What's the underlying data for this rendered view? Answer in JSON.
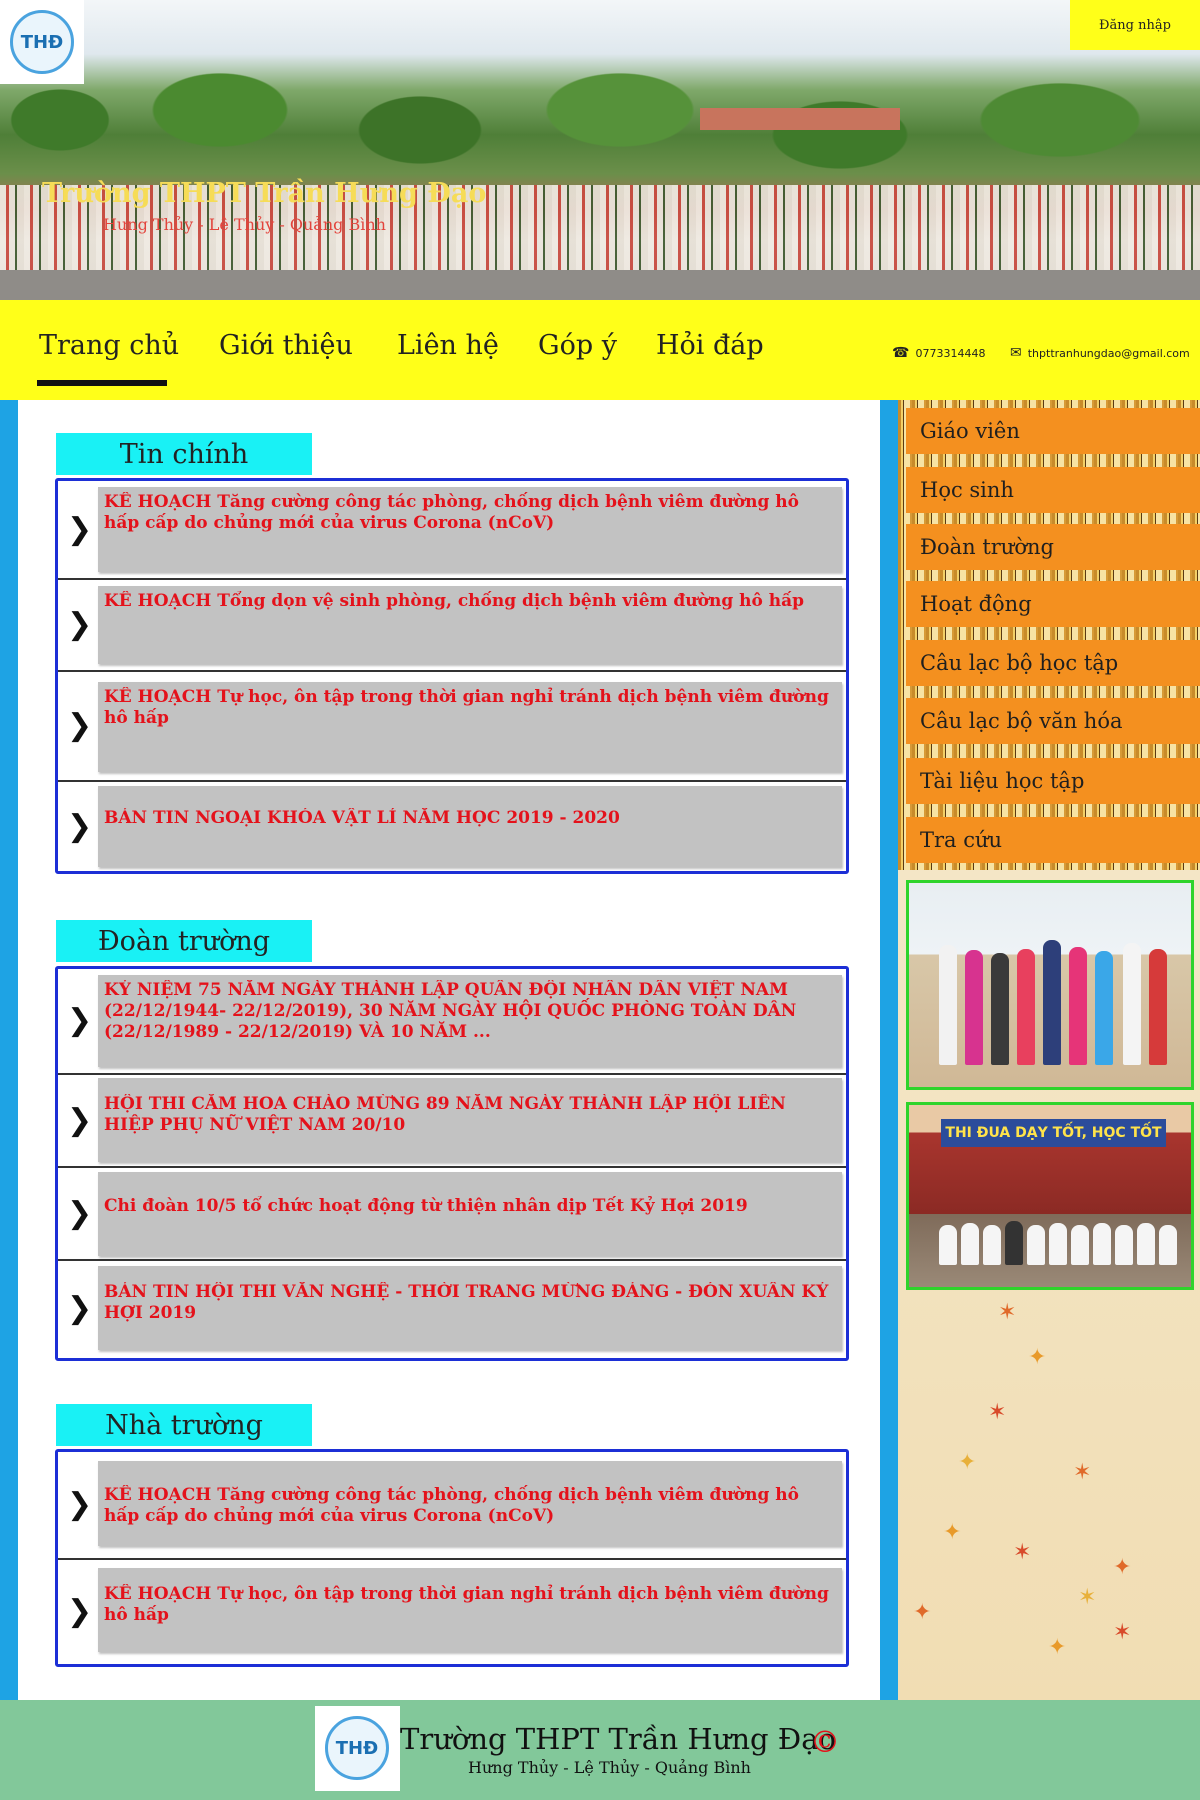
{
  "header": {
    "logo_text": "THĐ",
    "login_label": "Đăng nhập",
    "site_title": "Trường THPT Trần Hưng Đạo",
    "site_subtitle": "Hưng Thủy - Lệ Thủy - Quảng Bình"
  },
  "nav": {
    "items": [
      {
        "label": "Trang chủ"
      },
      {
        "label": "Giới thiệu"
      },
      {
        "label": "Liên hệ"
      },
      {
        "label": "Góp ý"
      },
      {
        "label": "Hỏi đáp"
      }
    ],
    "active_index": 0,
    "phone": "0773314448",
    "email": "thpttranhungdao@gmail.com"
  },
  "sections": [
    {
      "title": "Tin chính",
      "items": [
        {
          "text": "KẾ HOẠCH Tăng cường công tác phòng, chống dịch bệnh  viêm đường hô hấp cấp do chủng mới của virus Corona (nCoV)"
        },
        {
          "text": "KẾ HOẠCH Tổng dọn vệ sinh phòng, chống dịch bệnh viêm đường hô hấp"
        },
        {
          "text": "KẾ HOẠCH Tự học, ôn tập trong thời gian nghỉ tránh dịch bệnh viêm đường hô hấp"
        },
        {
          "text": "BẢN TIN NGOẠI KHÓA VẬT LÍ NĂM HỌC 2019 - 2020"
        }
      ]
    },
    {
      "title": "Đoàn trường",
      "items": [
        {
          "text": "KỶ NIỆM 75 NĂM NGÀY THÀNH LẬP QUÂN ĐỘI NHÂN DÂN VIỆT NAM (22/12/1944- 22/12/2019), 30 NĂM NGÀY HỘI QUỐC PHÒNG TOÀN DÂN (22/12/1989 - 22/12/2019) VÀ 10 NĂM ..."
        },
        {
          "text": "HỘI THI CẮM HOA CHÀO MỪNG 89 NĂM NGÀY THÀNH LẬP HỘI LIÊN HIỆP PHỤ NỮ VIỆT NAM 20/10"
        },
        {
          "text": "Chi đoàn 10/5 tổ chức hoạt động từ thiện nhân dịp Tết Kỷ Hợi 2019"
        },
        {
          "text": "BẢN TIN HỘI THI VĂN NGHỆ - THỜI TRANG MỪNG ĐẢNG - ĐÓN XUÂN KỶ HỢI 2019"
        }
      ]
    },
    {
      "title": "Nhà trường",
      "items": [
        {
          "text": "KẾ HOẠCH Tăng cường công tác phòng, chống dịch bệnh viêm đường hô hấp cấp do chủng mới của virus Corona (nCoV)"
        },
        {
          "text": "KẾ HOẠCH Tự học, ôn tập trong thời gian nghỉ tránh dịch bệnh viêm đường hô hấp"
        }
      ]
    }
  ],
  "sidebar": {
    "menu": [
      {
        "label": "Giáo viên"
      },
      {
        "label": "Học sinh"
      },
      {
        "label": "Đoàn trường"
      },
      {
        "label": "Hoạt động"
      },
      {
        "label": "Câu lạc bộ học tập"
      },
      {
        "label": "Câu lạc bộ văn hóa"
      },
      {
        "label": "Tài liệu học tập"
      },
      {
        "label": "Tra cứu"
      }
    ],
    "photo2_sign": "THI ĐUA DẠY TỐT, HỌC TỐT"
  },
  "footer": {
    "logo_text": "THĐ",
    "title": "Trường THPT Trần Hưng Đạo",
    "subtitle": "Hưng Thủy - Lệ Thủy - Quảng Bình",
    "copyright": "©"
  },
  "colors": {
    "nav_bg": "#ffff19",
    "section_tab": "#19f1f5",
    "box_border": "#1c2fd6",
    "headline": "#e4121b",
    "side_item": "#f4901f",
    "side_strip": "#1ea3e4",
    "footer_bg": "#82c89a"
  }
}
